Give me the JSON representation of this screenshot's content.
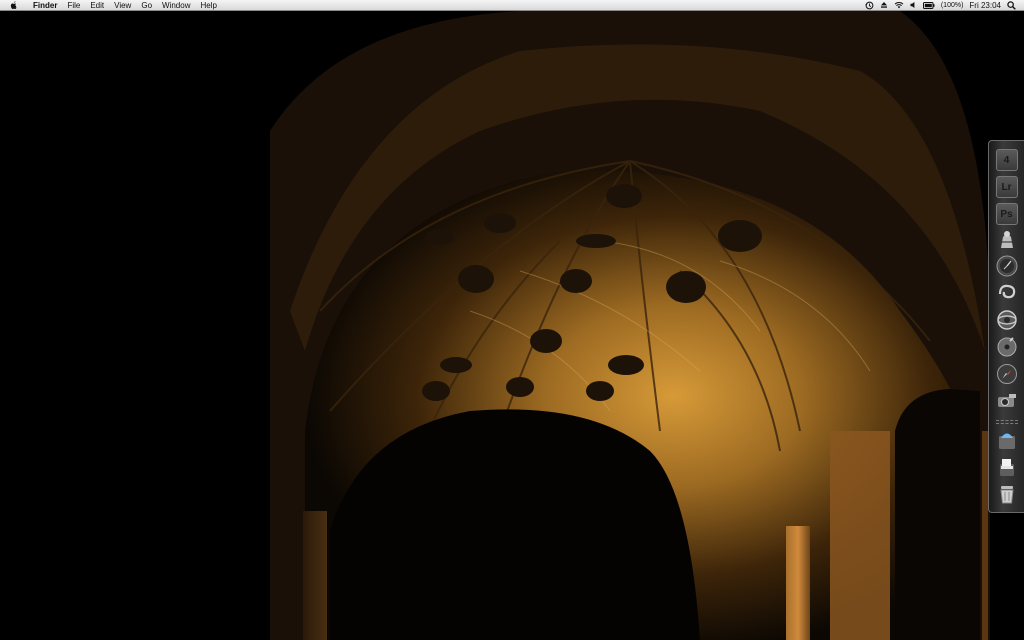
{
  "menubar": {
    "app_name": "Finder",
    "menus": [
      "File",
      "Edit",
      "View",
      "Go",
      "Window",
      "Help"
    ],
    "status": {
      "battery_text": "(100%)",
      "clock": "Fri 23:04"
    }
  },
  "dock": {
    "apps": [
      {
        "name": "final-cut-icon",
        "glyph": "4",
        "running": true
      },
      {
        "name": "lightroom-icon",
        "glyph": "Lr",
        "running": false
      },
      {
        "name": "photoshop-icon",
        "glyph": "Ps",
        "running": false
      },
      {
        "name": "script-editor-icon",
        "glyph": "",
        "running": true
      },
      {
        "name": "compass-clock-icon",
        "glyph": "",
        "running": false
      },
      {
        "name": "swirl-app-icon",
        "glyph": "",
        "running": true
      },
      {
        "name": "globe-browser-icon",
        "glyph": "",
        "running": true
      },
      {
        "name": "disk-utility-icon",
        "glyph": "",
        "running": false
      },
      {
        "name": "safari-icon",
        "glyph": "",
        "running": true
      },
      {
        "name": "camera-icon",
        "glyph": "",
        "running": true
      }
    ],
    "stacks": [
      {
        "name": "downloads-stack-icon"
      },
      {
        "name": "documents-stack-icon"
      },
      {
        "name": "trash-icon"
      }
    ]
  },
  "colors": {
    "menubar_bg": "#e6e6e6",
    "vault_gold": "#c8922e",
    "vault_shadow": "#2a1a08"
  }
}
